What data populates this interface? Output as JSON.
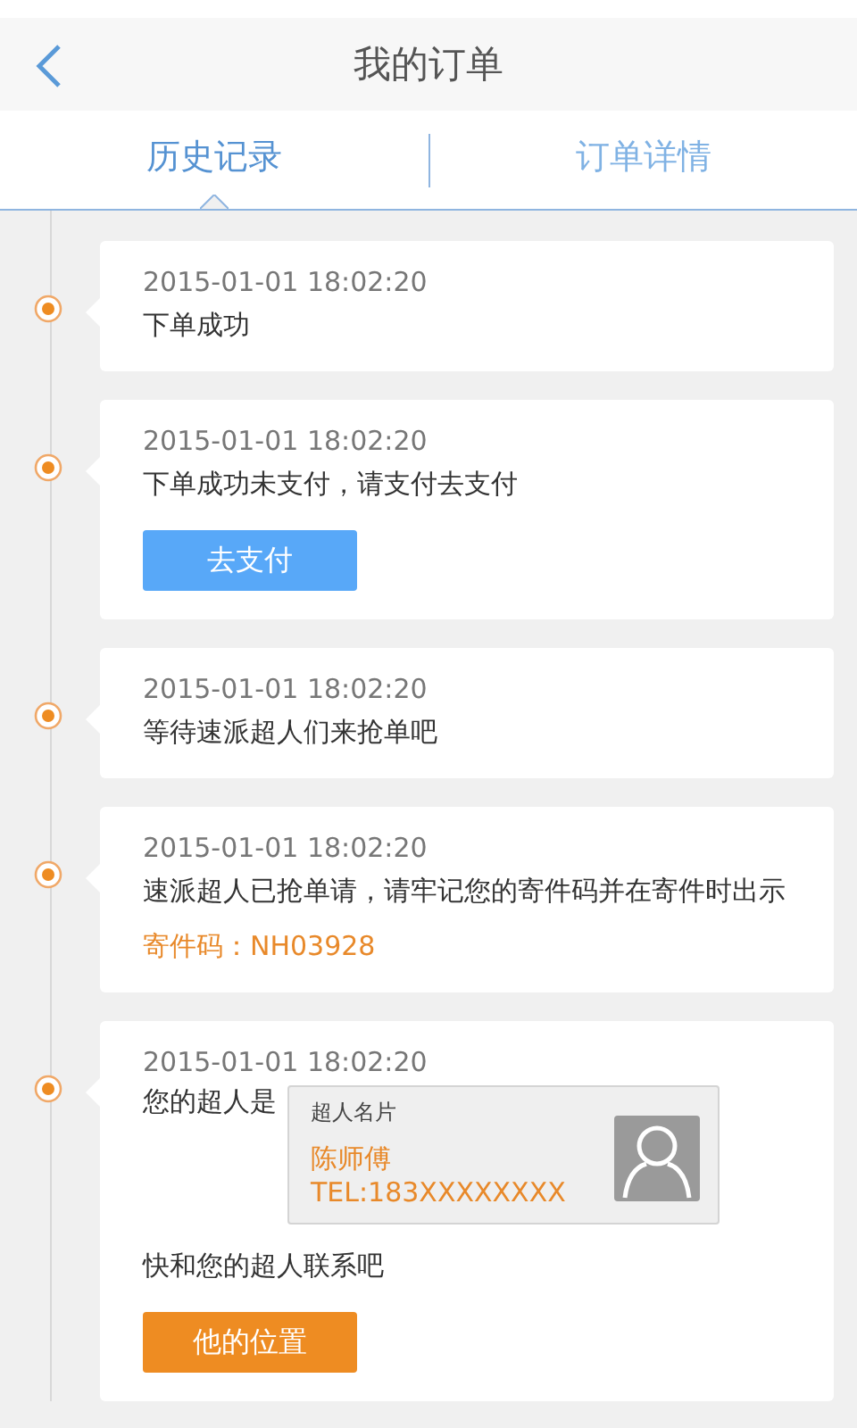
{
  "header": {
    "title": "我的订单"
  },
  "tabs": [
    {
      "label": "历史记录",
      "selected": true
    },
    {
      "label": "订单详情",
      "selected": false
    }
  ],
  "events": [
    {
      "kind": "plain",
      "time": "2015-01-01 18:02:20",
      "message": "下单成功"
    },
    {
      "kind": "pay",
      "time": "2015-01-01 18:02:20",
      "message": "下单成功未支付，请支付去支付",
      "button": "去支付"
    },
    {
      "kind": "plain",
      "time": "2015-01-01 18:02:20",
      "message": "等待速派超人们来抢单吧"
    },
    {
      "kind": "code",
      "time": "2015-01-01 18:02:20",
      "message": "速派超人已抢单请，请牢记您的寄件码并在寄件时出示",
      "code": "寄件码：NH03928"
    },
    {
      "kind": "courier",
      "time": "2015-01-01 18:02:20",
      "message": "您的超人是",
      "card": {
        "title": "超人名片",
        "name": "陈师傅",
        "phone": "TEL:183XXXXXXXX"
      },
      "note": "快和您的超人联系吧",
      "button": "他的位置"
    }
  ]
}
